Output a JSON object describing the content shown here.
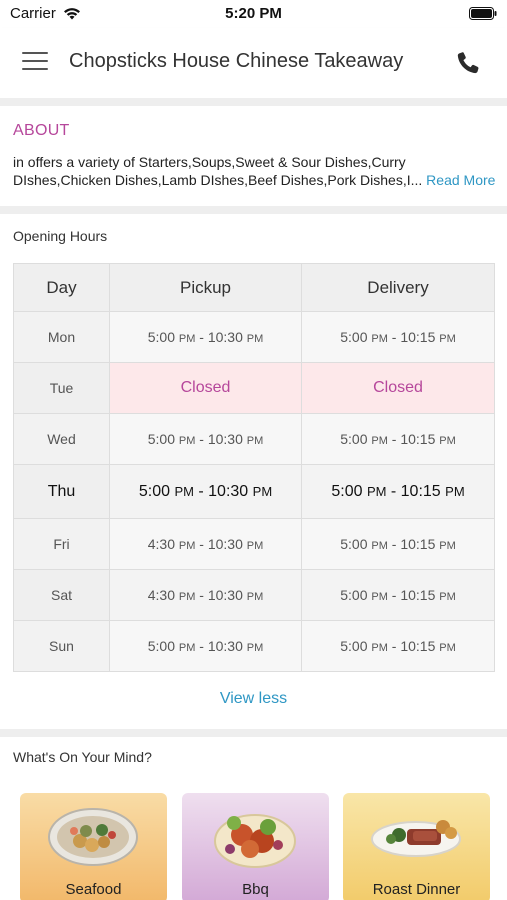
{
  "status": {
    "carrier": "Carrier",
    "time": "5:20 PM"
  },
  "header": {
    "title": "Chopsticks House Chinese Takeaway"
  },
  "about": {
    "heading": "ABOUT",
    "text": "in  offers a variety of Starters,Soups,Sweet & Sour Dishes,Curry DIshes,Chicken Dishes,Lamb DIshes,Beef Dishes,Pork Dishes,I...",
    "read_more": "Read More"
  },
  "hours": {
    "heading": "Opening Hours",
    "columns": [
      "Day",
      "Pickup",
      "Delivery"
    ],
    "rows": [
      {
        "day": "Mon",
        "pickup": [
          "5:00",
          "PM",
          " - 10:30",
          "PM"
        ],
        "delivery": [
          "5:00",
          "PM",
          " - 10:15",
          "PM"
        ]
      },
      {
        "day": "Tue",
        "pickup_closed": "Closed",
        "delivery_closed": "Closed"
      },
      {
        "day": "Wed",
        "pickup": [
          "5:00",
          "PM",
          " - 10:30",
          "PM"
        ],
        "delivery": [
          "5:00",
          "PM",
          " - 10:15",
          "PM"
        ]
      },
      {
        "day": "Thu",
        "pickup": [
          "5:00",
          "PM",
          " - 10:30",
          "PM"
        ],
        "delivery": [
          "5:00",
          "PM",
          " - 10:15",
          "PM"
        ]
      },
      {
        "day": "Fri",
        "pickup": [
          "4:30",
          "PM",
          " - 10:30",
          "PM"
        ],
        "delivery": [
          "5:00",
          "PM",
          " - 10:15",
          "PM"
        ]
      },
      {
        "day": "Sat",
        "pickup": [
          "4:30",
          "PM",
          " - 10:30",
          "PM"
        ],
        "delivery": [
          "5:00",
          "PM",
          " - 10:15",
          "PM"
        ]
      },
      {
        "day": "Sun",
        "pickup": [
          "5:00",
          "PM",
          " - 10:30",
          "PM"
        ],
        "delivery": [
          "5:00",
          "PM",
          " - 10:15",
          "PM"
        ]
      }
    ],
    "view_less": "View less"
  },
  "mind": {
    "heading": "What's On Your Mind?",
    "categories": [
      {
        "label": "Seafood",
        "color": "#f5c77e"
      },
      {
        "label": "Bbq",
        "color": "#d8b6d9"
      },
      {
        "label": "Roast Dinner",
        "color": "#f6d57d"
      }
    ]
  },
  "colors": {
    "accent": "#b6479b",
    "link": "#2f97c4",
    "closed_bg": "#fde8ea"
  },
  "icons": [
    "wifi-icon",
    "battery-icon",
    "menu-icon",
    "phone-icon"
  ]
}
